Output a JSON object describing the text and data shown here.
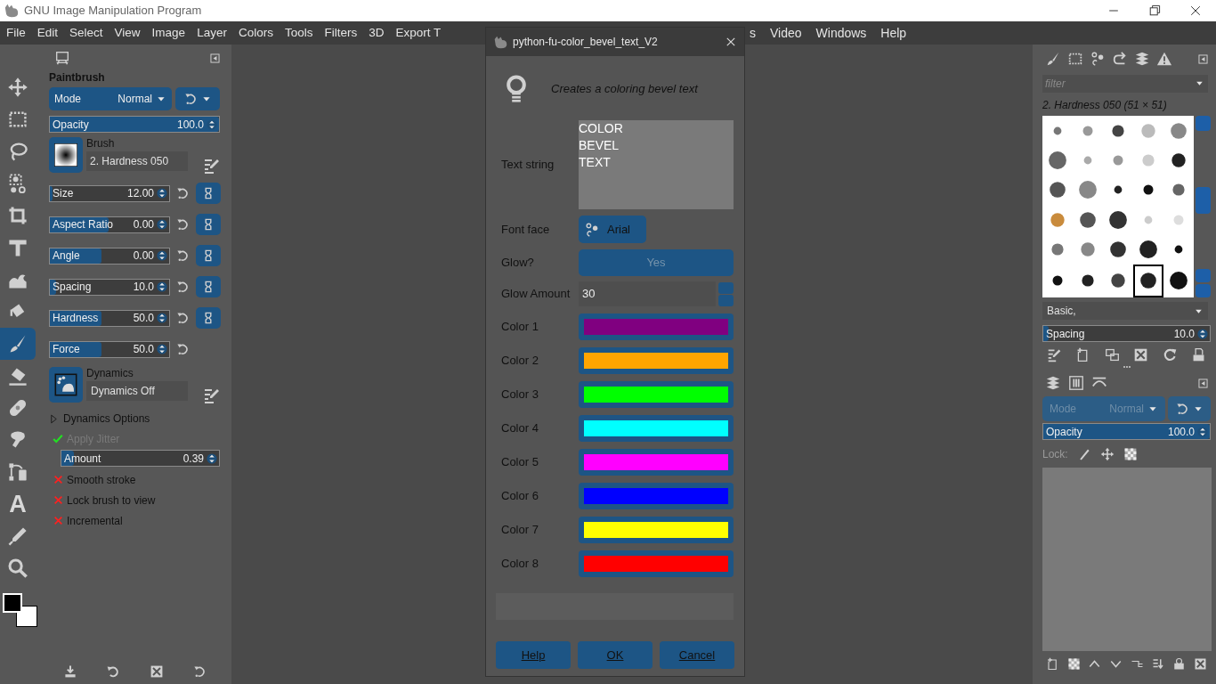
{
  "window": {
    "title": "GNU Image Manipulation Program"
  },
  "menu_left": [
    "File",
    "Edit",
    "Select",
    "View",
    "Image",
    "Layer",
    "Colors",
    "Tools",
    "Filters",
    "3D",
    "Export T"
  ],
  "menu_right": [
    "s",
    "Video",
    "Windows",
    "Help"
  ],
  "tools": [
    {
      "selected": false
    },
    {
      "selected": false
    },
    {
      "selected": false
    },
    {
      "selected": false
    },
    {
      "selected": false
    },
    {
      "selected": false
    },
    {
      "selected": false
    },
    {
      "selected": false
    },
    {
      "selected": true
    },
    {
      "selected": false
    },
    {
      "selected": false
    },
    {
      "selected": false
    },
    {
      "selected": false
    },
    {
      "selected": false
    },
    {
      "selected": false
    },
    {
      "selected": false
    }
  ],
  "text_tool_glyph": "A",
  "tool_options": {
    "title": "Paintbrush",
    "mode": {
      "label": "Mode",
      "value": "Normal"
    },
    "opacity": {
      "label": "Opacity",
      "value": "100.0",
      "level": 1
    },
    "brush": {
      "label": "Brush",
      "value": "2. Hardness 050"
    },
    "sliders": [
      {
        "label": "Size",
        "value": "12.00",
        "level": 0.02,
        "chain": true
      },
      {
        "label": "Aspect Ratio",
        "value": "0.00",
        "level": 0.49,
        "chain": true
      },
      {
        "label": "Angle",
        "value": "0.00",
        "level": 0.43,
        "chain": true
      },
      {
        "label": "Spacing",
        "value": "10.0",
        "level": 0.05,
        "chain": true
      },
      {
        "label": "Hardness",
        "value": "50.0",
        "level": 0.43,
        "chain": true
      },
      {
        "label": "Force",
        "value": "50.0",
        "level": 0.43,
        "chain": false
      }
    ],
    "dynamics": {
      "label": "Dynamics",
      "value": "Dynamics Off"
    },
    "dynamics_options": {
      "label": "Dynamics Options",
      "expanded": false
    },
    "apply_jitter": {
      "label": "Apply Jitter",
      "checked": true,
      "disabled": true
    },
    "amount": {
      "label": "Amount",
      "value": "0.39",
      "level": 0.08
    },
    "options": [
      {
        "label": "Smooth stroke",
        "checked": false
      },
      {
        "label": "Lock brush to view",
        "checked": false
      },
      {
        "label": "Incremental",
        "checked": false
      }
    ]
  },
  "brushes": {
    "filter_placeholder": "filter",
    "current": "2. Hardness 050 (51 × 51)",
    "tag": "Basic,",
    "grid": [
      {
        "selected": false
      },
      {
        "selected": false
      },
      {
        "selected": false
      },
      {
        "selected": false
      },
      {
        "selected": false
      },
      {
        "selected": false
      },
      {
        "selected": false
      },
      {
        "selected": false
      },
      {
        "selected": false
      },
      {
        "selected": false
      },
      {
        "selected": false
      },
      {
        "selected": false
      },
      {
        "selected": false
      },
      {
        "selected": false
      },
      {
        "selected": false
      },
      {
        "selected": false
      },
      {
        "selected": false
      },
      {
        "selected": false
      },
      {
        "selected": false
      },
      {
        "selected": false
      },
      {
        "selected": false
      },
      {
        "selected": false
      },
      {
        "selected": false
      },
      {
        "selected": false
      },
      {
        "selected": false
      },
      {
        "selected": false
      },
      {
        "selected": false
      },
      {
        "selected": false
      },
      {
        "selected": true
      },
      {
        "selected": false
      }
    ],
    "spacing": {
      "label": "Spacing",
      "value": "10.0",
      "level": 0.03
    }
  },
  "layers": {
    "mode": {
      "label": "Mode",
      "value": "Normal",
      "disabled": true
    },
    "opacity": {
      "label": "Opacity",
      "value": "100.0",
      "level": 1
    },
    "lock_label": "Lock:"
  },
  "dialog": {
    "title": "python-fu-color_bevel_text_V2",
    "description": "Creates a coloring bevel text",
    "text_string": {
      "label": "Text string",
      "value": "COLOR\nBEVEL\nTEXT"
    },
    "font": {
      "label": "Font face",
      "value": "Arial"
    },
    "glow": {
      "label": "Glow?",
      "value": "Yes",
      "on": true
    },
    "glow_amount": {
      "label": "Glow Amount",
      "value": "30"
    },
    "colors": [
      {
        "label": "Color 1",
        "color": "#800080"
      },
      {
        "label": "Color 2",
        "color": "#ffa500"
      },
      {
        "label": "Color 3",
        "color": "#00ff00"
      },
      {
        "label": "Color 4",
        "color": "#00ffff"
      },
      {
        "label": "Color 5",
        "color": "#ff00ff"
      },
      {
        "label": "Color 6",
        "color": "#0000ff"
      },
      {
        "label": "Color 7",
        "color": "#ffff00"
      },
      {
        "label": "Color 8",
        "color": "#ff0000"
      }
    ],
    "progress": {
      "level": 0
    },
    "buttons": [
      "Help",
      "OK",
      "Cancel"
    ]
  }
}
